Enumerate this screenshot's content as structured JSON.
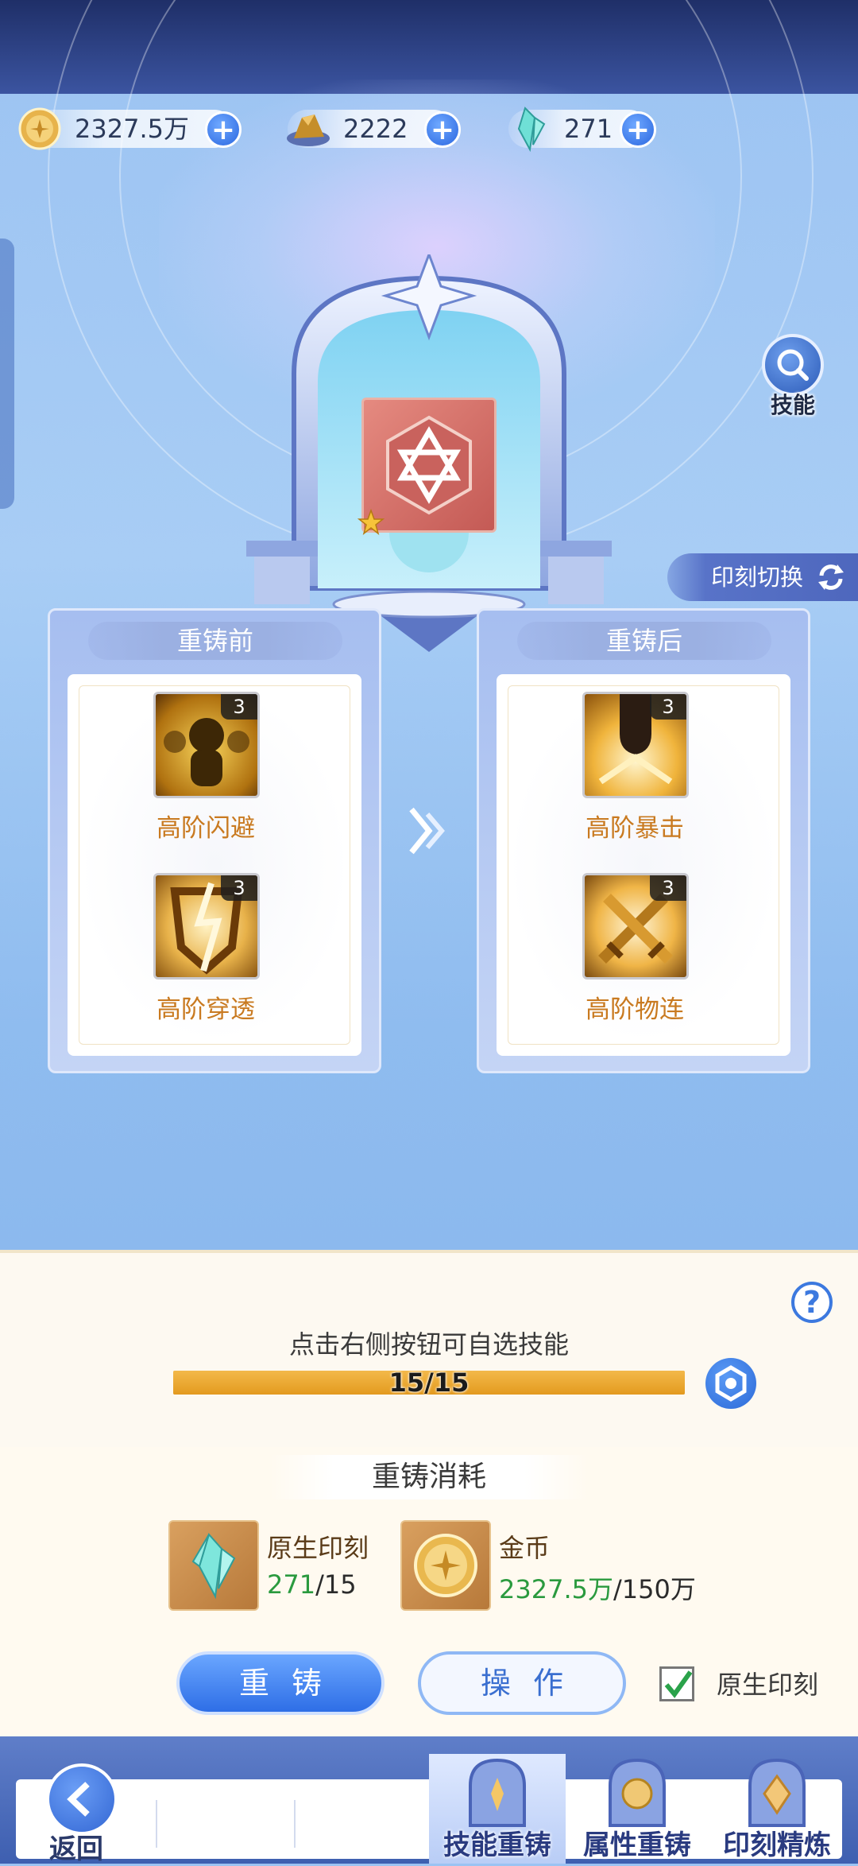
{
  "currencies": [
    {
      "name": "gold-coin",
      "value": "2327.5万"
    },
    {
      "name": "ore",
      "value": "2222"
    },
    {
      "name": "crystal",
      "value": "271"
    }
  ],
  "skill_button": {
    "label": "技能"
  },
  "switch_button": {
    "label": "印刻切换"
  },
  "before": {
    "title": "重铸前",
    "skills": [
      {
        "name": "高阶闪避",
        "level": "3"
      },
      {
        "name": "高阶穿透",
        "level": "3"
      }
    ]
  },
  "after": {
    "title": "重铸后",
    "skills": [
      {
        "name": "高阶暴击",
        "level": "3"
      },
      {
        "name": "高阶物连",
        "level": "3"
      }
    ]
  },
  "progress": {
    "hint": "点击右侧按钮可自选技能",
    "text": "15/15",
    "fraction": 1.0
  },
  "cost": {
    "title": "重铸消耗",
    "items": [
      {
        "name": "原生印刻",
        "have": "271",
        "need": "/15"
      },
      {
        "name": "金币",
        "have": "2327.5万",
        "need": "/150万"
      }
    ]
  },
  "buttons": {
    "recast": "重铸",
    "operate": "操作"
  },
  "checkbox": {
    "label": "原生印刻",
    "checked": true
  },
  "nav": {
    "back": "返回",
    "tabs": [
      {
        "label": "技能重铸",
        "active": true
      },
      {
        "label": "属性重铸",
        "active": false
      },
      {
        "label": "印刻精炼",
        "active": false
      }
    ]
  },
  "colors": {
    "accent": "#2e6ee6",
    "skill_name": "#c97a20",
    "have_amount": "#2a9a3e",
    "progress": "#e39a1f"
  }
}
